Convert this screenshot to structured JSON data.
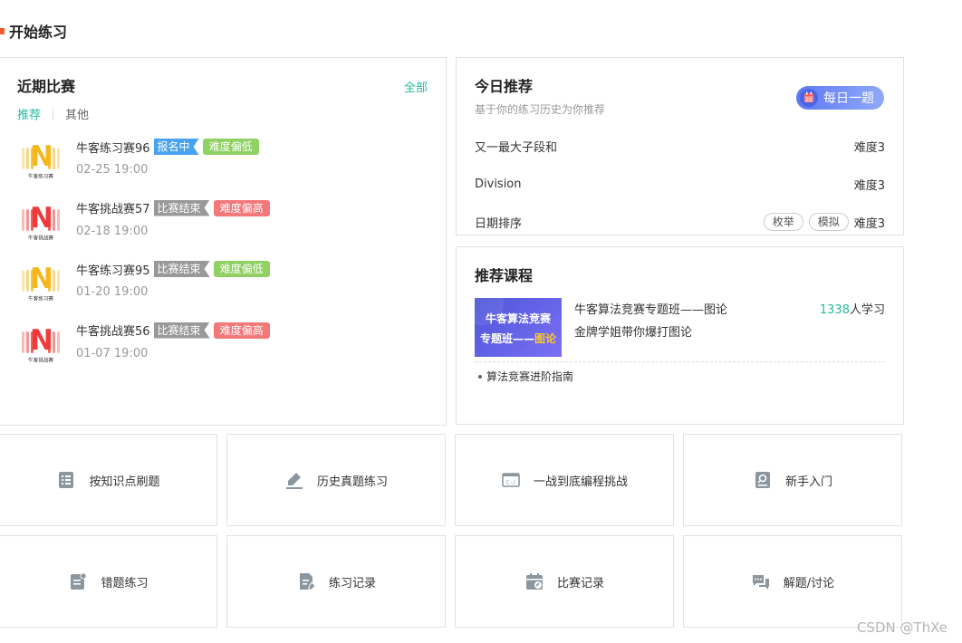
{
  "section_title": "开始练习",
  "contest_panel": {
    "title": "近期比赛",
    "all_link": "全部",
    "tabs": [
      "推荐",
      "其他"
    ],
    "items": [
      {
        "name": "牛客练习赛96",
        "status": "报名中",
        "status_color": "#4aa3f0",
        "difficulty": "难度偏低",
        "difficulty_color": "#8fd163",
        "date": "02-25 19:00",
        "logo_letter": "N",
        "logo_color": "#f4b71e",
        "logo_caption": "牛客练习赛"
      },
      {
        "name": "牛客挑战赛57",
        "status": "比赛结束",
        "status_color": "#999999",
        "difficulty": "难度偏高",
        "difficulty_color": "#f2787a",
        "date": "02-18 19:00",
        "logo_letter": "N",
        "logo_color": "#ef3b3b",
        "logo_caption": "牛客挑战赛"
      },
      {
        "name": "牛客练习赛95",
        "status": "比赛结束",
        "status_color": "#999999",
        "difficulty": "难度偏低",
        "difficulty_color": "#8fd163",
        "date": "01-20 19:00",
        "logo_letter": "N",
        "logo_color": "#f4b71e",
        "logo_caption": "牛客练习赛"
      },
      {
        "name": "牛客挑战赛56",
        "status": "比赛结束",
        "status_color": "#999999",
        "difficulty": "难度偏高",
        "difficulty_color": "#f2787a",
        "date": "01-07 19:00",
        "logo_letter": "N",
        "logo_color": "#ef3b3b",
        "logo_caption": "牛客挑战赛"
      }
    ]
  },
  "today_panel": {
    "title": "今日推荐",
    "subtitle": "基于你的练习历史为你推荐",
    "daily_button": "每日一题",
    "rows": [
      {
        "name": "又一最大子段和",
        "tags": [],
        "difficulty": "难度3"
      },
      {
        "name": "Division",
        "tags": [],
        "difficulty": "难度3"
      },
      {
        "name": "日期排序",
        "tags": [
          "枚举",
          "模拟"
        ],
        "difficulty": "难度3"
      }
    ]
  },
  "course_panel": {
    "title": "推荐课程",
    "cover_line1": "牛客算法竞赛",
    "cover_line2_a": "专题班——",
    "cover_line2_b": "图论",
    "course_name": "牛客算法竞赛专题班——图论",
    "course_desc": "金牌学姐带你爆打图论",
    "learners_num": "1338",
    "learners_suffix": "人学习",
    "guide": "算法竞赛进阶指南"
  },
  "tiles": [
    {
      "label": "按知识点刷题",
      "icon": "list-icon"
    },
    {
      "label": "历史真题练习",
      "icon": "pen-icon"
    },
    {
      "label": "一战到底编程挑战",
      "icon": "code-window-icon"
    },
    {
      "label": "新手入门",
      "icon": "search-doc-icon"
    },
    {
      "label": "错题练习",
      "icon": "error-doc-icon"
    },
    {
      "label": "练习记录",
      "icon": "edit-doc-icon"
    },
    {
      "label": "比赛记录",
      "icon": "calendar-edit-icon"
    },
    {
      "label": "解题/讨论",
      "icon": "chat-icon"
    }
  ],
  "watermark": "CSDN @ThXe",
  "colors": {
    "accent": "#25bb9b",
    "title_mark": "#f25c2c",
    "icon_gray": "#8c969e"
  }
}
